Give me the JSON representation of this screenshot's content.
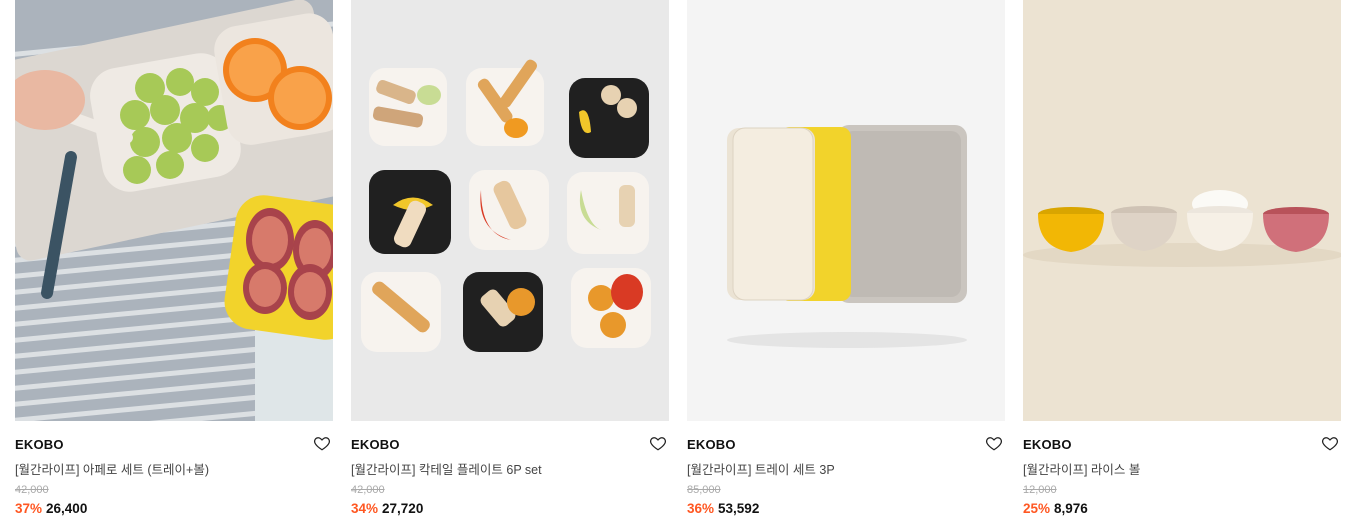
{
  "products": [
    {
      "brand": "EKOBO",
      "title": "[월간라이프] 아페로 세트 (트레이+볼)",
      "original_price": "42,000",
      "discount": "37%",
      "price": "26,400",
      "image_desc": "tray-grapes-oranges-figs"
    },
    {
      "brand": "EKOBO",
      "title": "[월간라이프] 칵테일 플레이트 6P set",
      "original_price": "42,000",
      "discount": "34%",
      "price": "27,720",
      "image_desc": "cocktail-plates-grid"
    },
    {
      "brand": "EKOBO",
      "title": "[월간라이프] 트레이 세트 3P",
      "original_price": "85,000",
      "discount": "36%",
      "price": "53,592",
      "image_desc": "stacked-trays"
    },
    {
      "brand": "EKOBO",
      "title": "[월간라이프] 라이스 볼",
      "original_price": "12,000",
      "discount": "25%",
      "price": "8,976",
      "image_desc": "rice-bowls"
    }
  ],
  "colors": {
    "discount": "#ff5722",
    "original_price": "#aaaaaa"
  }
}
